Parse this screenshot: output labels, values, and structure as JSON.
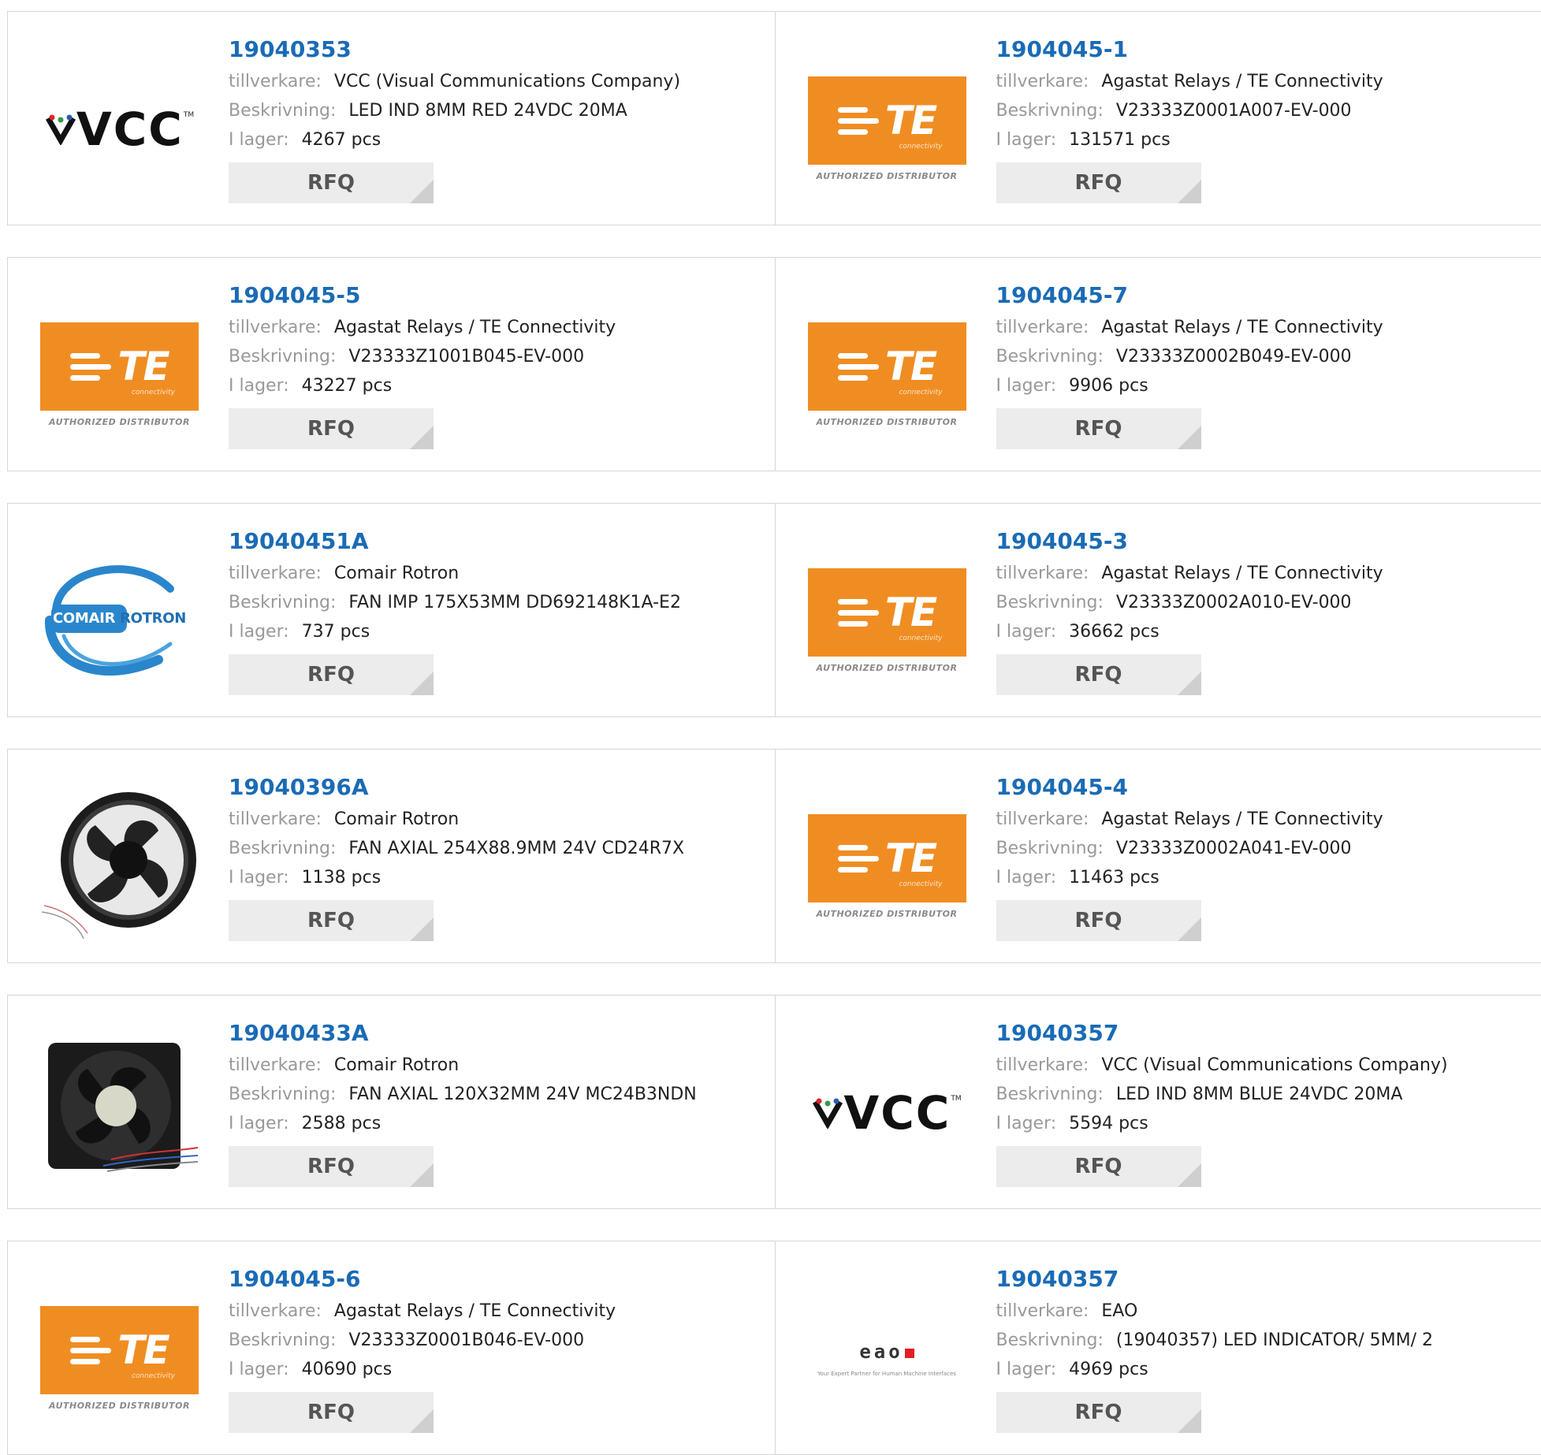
{
  "labels": {
    "manufacturer": "tillverkare:",
    "description": "Beskrivning:",
    "stock": "I lager:",
    "rfq": "RFQ"
  },
  "logo_text": {
    "te": "TE",
    "te_sub": "connectivity",
    "te_auth": "AUTHORIZED DISTRIBUTOR",
    "vcc": "VCC",
    "vcc_tm": "TM",
    "comair_a": "COMAIR",
    "comair_b": "ROTRON",
    "eao": "eao",
    "eao_tag": "Your Expert Partner for Human Machine Interfaces"
  },
  "colors": {
    "link": "#1a6bb5",
    "te_orange": "#f08d22",
    "label_gray": "#999999",
    "rfq_bg": "#ececec"
  },
  "products": [
    {
      "part": "19040353",
      "manufacturer": "VCC (Visual Communications Company)",
      "description": "LED IND 8MM RED 24VDC 20MA",
      "stock": "4267 pcs",
      "logo": "vcc"
    },
    {
      "part": "1904045-1",
      "manufacturer": "Agastat Relays / TE Connectivity",
      "description": "V23333Z0001A007-EV-000",
      "stock": "131571 pcs",
      "logo": "te"
    },
    {
      "part": "1904045-5",
      "manufacturer": "Agastat Relays / TE Connectivity",
      "description": "V23333Z1001B045-EV-000",
      "stock": "43227 pcs",
      "logo": "te"
    },
    {
      "part": "1904045-7",
      "manufacturer": "Agastat Relays / TE Connectivity",
      "description": "V23333Z0002B049-EV-000",
      "stock": "9906 pcs",
      "logo": "te"
    },
    {
      "part": "19040451A",
      "manufacturer": "Comair Rotron",
      "description": "FAN IMP 175X53MM DD692148K1A-E2",
      "stock": "737 pcs",
      "logo": "comair"
    },
    {
      "part": "1904045-3",
      "manufacturer": "Agastat Relays / TE Connectivity",
      "description": "V23333Z0002A010-EV-000",
      "stock": "36662 pcs",
      "logo": "te"
    },
    {
      "part": "19040396A",
      "manufacturer": "Comair Rotron",
      "description": "FAN AXIAL 254X88.9MM 24V CD24R7X",
      "stock": "1138 pcs",
      "logo": "round-fan"
    },
    {
      "part": "1904045-4",
      "manufacturer": "Agastat Relays / TE Connectivity",
      "description": "V23333Z0002A041-EV-000",
      "stock": "11463 pcs",
      "logo": "te"
    },
    {
      "part": "19040433A",
      "manufacturer": "Comair Rotron",
      "description": "FAN AXIAL 120X32MM 24V MC24B3NDN",
      "stock": "2588 pcs",
      "logo": "square-fan"
    },
    {
      "part": "19040357",
      "manufacturer": "VCC (Visual Communications Company)",
      "description": "LED IND 8MM BLUE 24VDC 20MA",
      "stock": "5594 pcs",
      "logo": "vcc"
    },
    {
      "part": "1904045-6",
      "manufacturer": "Agastat Relays / TE Connectivity",
      "description": "V23333Z0001B046-EV-000",
      "stock": "40690 pcs",
      "logo": "te"
    },
    {
      "part": "19040357",
      "manufacturer": "EAO",
      "description": "(19040357) LED INDICATOR/ 5MM/ 2",
      "stock": "4969 pcs",
      "logo": "eao"
    }
  ]
}
